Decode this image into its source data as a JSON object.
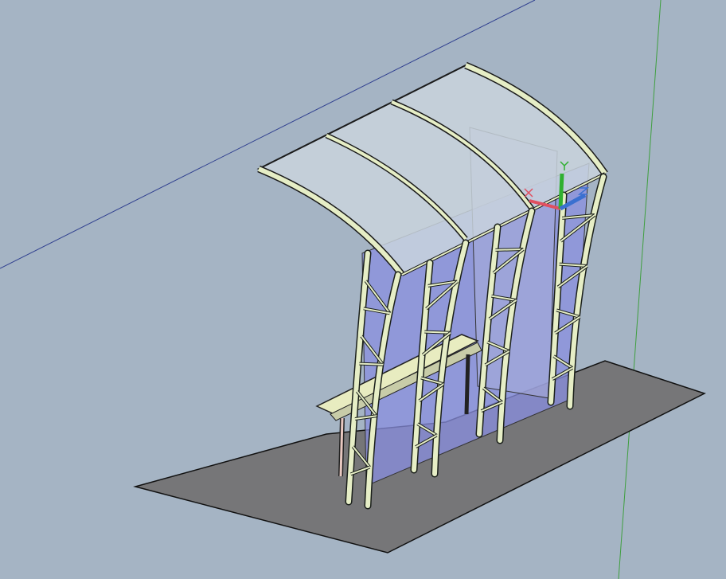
{
  "viewport": {
    "background_color": "#a5b4c4",
    "ground_color": "#767678",
    "glass_color": "#8a8fe0",
    "roof_color": "#c9d3dd",
    "frame_color": "#e6eec6",
    "grid_x_axis_color": "#2f3f8f",
    "grid_y_axis_color": "#3f9f3f"
  },
  "ucs_icon": {
    "x_axis": {
      "label": "X",
      "color": "#e05060"
    },
    "y_axis": {
      "label": "Y",
      "color": "#30b030"
    },
    "z_axis": {
      "label": "Z",
      "color": "#3a70d0"
    }
  }
}
